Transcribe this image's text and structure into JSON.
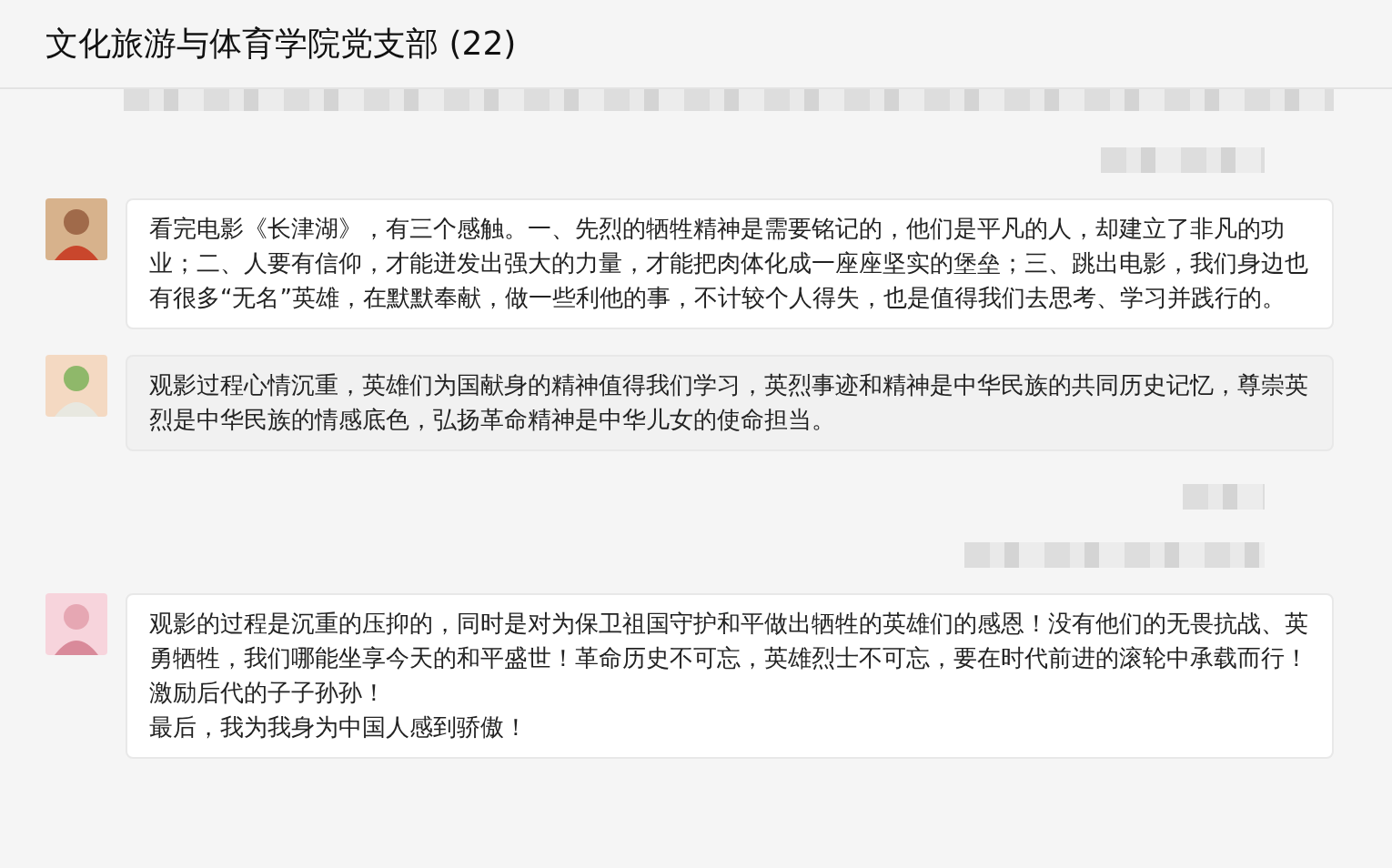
{
  "window": {
    "title": "文化旅游与体育学院党支部 (22)"
  },
  "messages": [
    {
      "kind": "blurred_bubble"
    },
    {
      "kind": "blurred_note"
    },
    {
      "kind": "text",
      "highlighted": false,
      "paragraphs": [
        "看完电影《长津湖》，有三个感触。一、先烈的牺牲精神是需要铭记的，他们是平凡的人，却建立了非凡的功业；二、人要有信仰，才能迸发出强大的力量，才能把肉体化成一座座坚实的堡垒；三、跳出电影，我们身边也有很多“无名”英雄，在默默奉献，做一些利他的事，不计较个人得失，也是值得我们去思考、学习并践行的。"
      ]
    },
    {
      "kind": "text",
      "highlighted": true,
      "paragraphs": [
        "观影过程心情沉重，英雄们为国献身的精神值得我们学习，英烈事迹和精神是中华民族的共同历史记忆，尊崇英烈是中华民族的情感底色，弘扬革命精神是中华儿女的使命担当。"
      ]
    },
    {
      "kind": "blurred_note"
    },
    {
      "kind": "blurred_note"
    },
    {
      "kind": "text",
      "highlighted": false,
      "paragraphs": [
        "观影的过程是沉重的压抑的，同时是对为保卫祖国守护和平做出牺牲的英雄们的感恩！没有他们的无畏抗战、英勇牺牲，我们哪能坐享今天的和平盛世！革命历史不可忘，英雄烈士不可忘，要在时代前进的滚轮中承载而行！激励后代的子子孙孙！",
        "最后，我为我身为中国人感到骄傲！"
      ]
    }
  ]
}
